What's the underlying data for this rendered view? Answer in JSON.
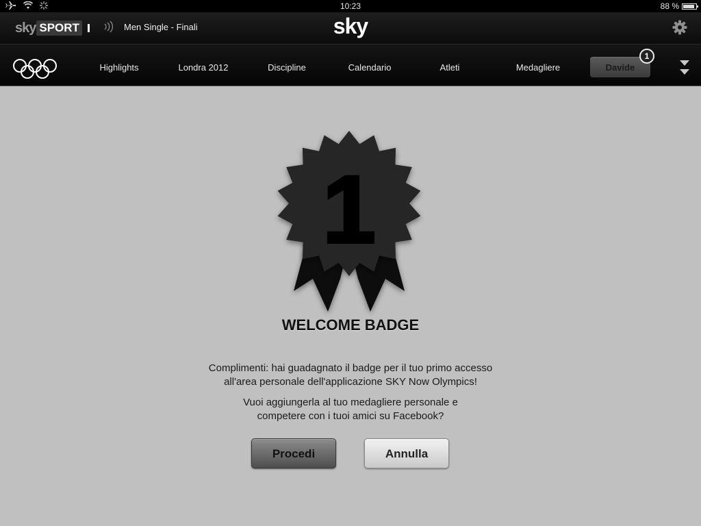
{
  "status_bar": {
    "time": "10:23",
    "battery_text": "88 %",
    "battery_level": 0.88,
    "icons": [
      "airplane-icon",
      "wifi-icon",
      "activity-spinner-icon",
      "battery-icon"
    ]
  },
  "header": {
    "brand_sky": "sky",
    "brand_sport": "SPORT",
    "live_icon": "))) ",
    "event_title": "Men Single - Finali",
    "center_logo": "sky",
    "settings_icon": "gear-icon"
  },
  "nav": {
    "logo_icon": "olympic-rings-icon",
    "items": [
      {
        "label": "Highlights"
      },
      {
        "label": "Londra 2012"
      },
      {
        "label": "Discipline"
      },
      {
        "label": "Calendario"
      },
      {
        "label": "Atleti"
      },
      {
        "label": "Medagliere"
      }
    ],
    "user_button": "Davide",
    "notification_count": "1",
    "more_icon": "double-chevron-down-icon"
  },
  "badge": {
    "number": "1",
    "title": "WELCOME BADGE",
    "message1_line1": "Complimenti: hai guadagnato il badge per il tuo primo accesso",
    "message1_line2": "all'area personale dell'applicazione SKY Now Olympics!",
    "message2_line1": "Vuoi aggiungerla al tuo medagliere personale e",
    "message2_line2": "competere con i tuoi amici su Facebook?"
  },
  "buttons": {
    "procedi": "Procedi",
    "annulla": "Annulla"
  },
  "colors": {
    "background": "#c0c0c0",
    "bar_dark": "#0c0c0c",
    "badge": "#262626"
  }
}
